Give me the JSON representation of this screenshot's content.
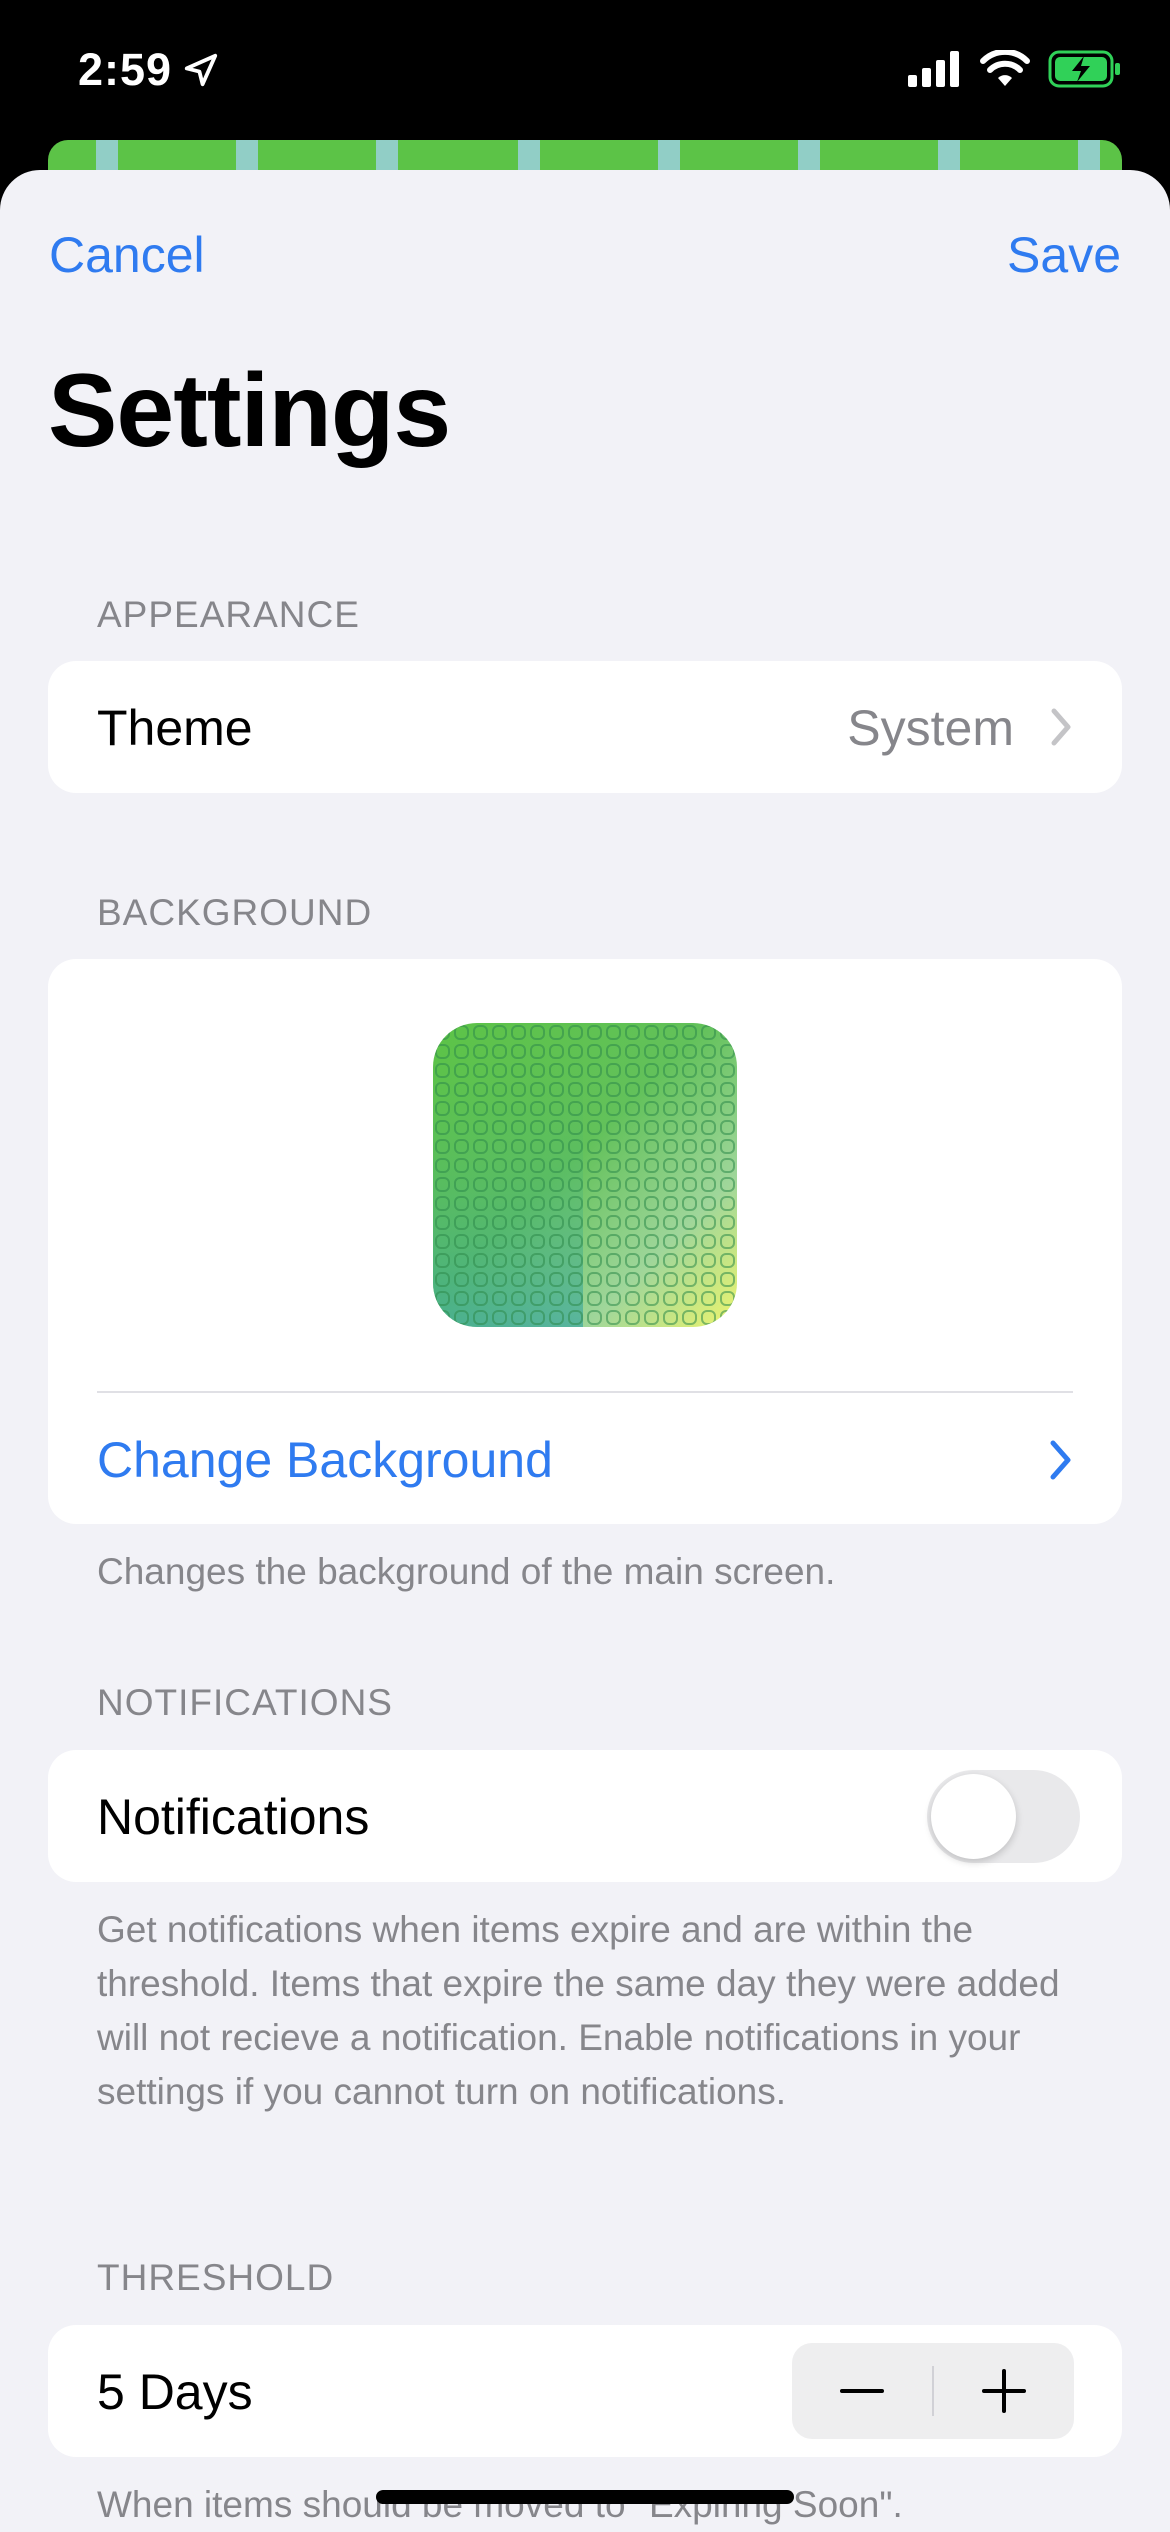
{
  "status_bar": {
    "time": "2:59",
    "location_icon": "location-arrow-icon",
    "signal_icon": "cellular-signal-icon",
    "wifi_icon": "wifi-icon",
    "battery_icon": "battery-charging-icon",
    "battery_color": "#30d158"
  },
  "nav": {
    "cancel_label": "Cancel",
    "save_label": "Save",
    "accent_color": "#2f7bf0"
  },
  "page": {
    "title": "Settings"
  },
  "appearance": {
    "header": "APPEARANCE",
    "theme_label": "Theme",
    "theme_value": "System",
    "chevron_icon": "chevron-right-icon"
  },
  "background": {
    "header": "BACKGROUND",
    "preview_icon": "background-pattern-preview",
    "change_label": "Change Background",
    "footer": "Changes the background of the main screen.",
    "gradient_colors": [
      "#5cc347",
      "#3aa6a0",
      "#e6f27a"
    ]
  },
  "notifications": {
    "header": "NOTIFICATIONS",
    "label": "Notifications",
    "enabled": false,
    "footer": "Get notifications when items expire and are within the threshold. Items that expire the same day they were added will not recieve a notification. Enable notifications in your settings if you cannot turn on notifications."
  },
  "threshold": {
    "header": "THRESHOLD",
    "value_label": "5 Days",
    "minus_icon": "minus-icon",
    "plus_icon": "plus-icon",
    "footer": "When items should be moved to \"Expiring Soon\"."
  }
}
